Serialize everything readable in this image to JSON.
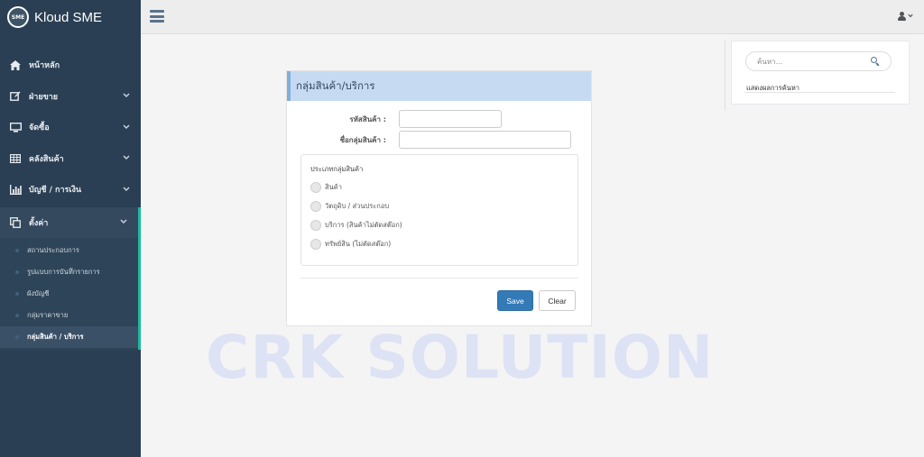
{
  "brand": {
    "logo_text": "SME",
    "name": "Kloud SME"
  },
  "sidebar": {
    "items": [
      {
        "label": "หน้าหลัก",
        "icon": "home-icon",
        "chevron": ""
      },
      {
        "label": "ฝ่ายขาย",
        "icon": "edit-icon",
        "chevron": "⌄"
      },
      {
        "label": "จัดซื้อ",
        "icon": "desktop-icon",
        "chevron": "⌄"
      },
      {
        "label": "คลังสินค้า",
        "icon": "table-icon",
        "chevron": "⌄"
      },
      {
        "label": "บัญชี / การเงิน",
        "icon": "bar-chart-icon",
        "chevron": "⌄"
      },
      {
        "label": "ตั้งค่า",
        "icon": "clone-icon",
        "chevron": "⌃"
      }
    ],
    "settings_submenu": [
      {
        "label": "สถานประกอบการ"
      },
      {
        "label": "รูปแบบการบันทึกรายการ"
      },
      {
        "label": "ผังบัญชี"
      },
      {
        "label": "กลุ่มราคาขาย"
      },
      {
        "label": "กลุ่มสินค้า / บริการ"
      }
    ]
  },
  "search": {
    "placeholder": "ค้นหา...",
    "results_label": "แสดงผลการค้นหา"
  },
  "form": {
    "title": "กลุ่มสินค้า/บริการ",
    "code_label": "รหัสสินค้า :",
    "code_value": "",
    "name_label": "ชื่อกลุ่มสินค้า :",
    "name_value": "",
    "type_group_title": "ประเภทกลุ่มสินค้า",
    "type_options": [
      {
        "label": "สินค้า"
      },
      {
        "label": "วัตถุดิบ / ส่วนประกอบ"
      },
      {
        "label": "บริการ (สินค้าไม่ตัดสต๊อก)"
      },
      {
        "label": "ทรัพย์สิน (ไม่ตัดสต๊อก)"
      }
    ],
    "save_label": "Save",
    "clear_label": "Clear"
  },
  "watermark": "CRK SOLUTION",
  "colors": {
    "sidebar_bg": "#2a3f54",
    "active_accent": "#1abb9c",
    "header_bg": "#c6dbf1",
    "save_button": "#337ab7"
  }
}
